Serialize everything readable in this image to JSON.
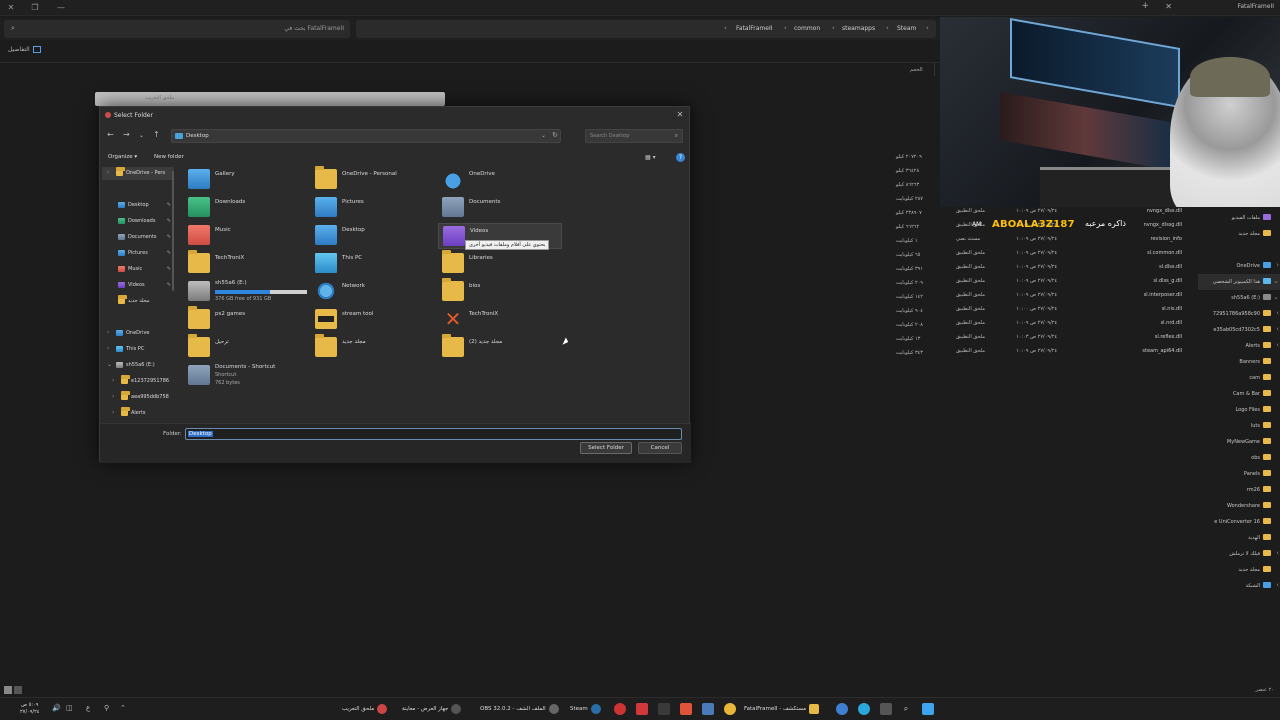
{
  "explorer": {
    "window_title": "FatalFrameII",
    "search_placeholder": "بحث في FatalFrameII",
    "breadcrumb": [
      "FatalFrameII",
      "common",
      "steamapps",
      "Steam"
    ],
    "details_label": "التفاصيل",
    "col_size": "الحجم",
    "sizes": [
      "٢٠٧٢٠٩ كيلو",
      "٣٦٤٢٨ كيلو",
      "٨٦٢٦٣ كيلو",
      "٢٨٧ كيلوبايت",
      "٢٣٨٩٠٧ كيلو",
      "٦٦٢٦٢ كيلو",
      "١ كيلوبايت",
      "٦٥ كيلوبايت",
      "٣٩١ كيلوبايت",
      "٢٠٩ كيلوبايت",
      "١٤٢ كيلوبايت",
      "٩٠٤ كيلوبايت",
      "٢٠٨ كيلوبايت",
      "١٣ كيلوبايت",
      "٣٤٣ كيلوبايت"
    ],
    "files": [
      {
        "name": "nvngx_dlss.dll",
        "date": "٢٧/٠٩/٢٤ ص ١٠:٠٩",
        "type": "ملحق التطبيق"
      },
      {
        "name": "nvngx_dlssg.dll",
        "date": "٢٧/٠٩/٢٤ ص ١٠:٠٩",
        "type": "ملحق التطبيق"
      },
      {
        "name": "revision_info",
        "date": "٢٧/٠٩/٢٤ ص ١٠:٠٩",
        "type": "مستند نصي"
      },
      {
        "name": "sl.common.dll",
        "date": "٢٧/٠٩/٢٤ ص ١٠:٠٩",
        "type": "ملحق التطبيق"
      },
      {
        "name": "sl.dlss.dll",
        "date": "٢٧/٠٩/٢٤ ص ١٠:٠٩",
        "type": "ملحق التطبيق"
      },
      {
        "name": "sl.dlss_g.dll",
        "date": "٢٧/٠٩/٢٤ ص ١٠:٠٩",
        "type": "ملحق التطبيق"
      },
      {
        "name": "sl.interposer.dll",
        "date": "٢٧/٠٩/٢٤ ص ١٠:٠٩",
        "type": "ملحق التطبيق"
      },
      {
        "name": "sl.nis.dll",
        "date": "٢٧/٠٩/٢٤ ص ١٠:٠٠",
        "type": "ملحق التطبيق"
      },
      {
        "name": "sl.nrd.dll",
        "date": "٢٧/٠٩/٢٤ ص ١٠:٠٩",
        "type": "ملحق التطبيق"
      },
      {
        "name": "sl.reflex.dll",
        "date": "٢٧/٠٩/٢٤ ص ١٠:٠٣",
        "type": "ملحق التطبيق"
      },
      {
        "name": "steam_api64.dll",
        "date": "٢٧/٠٩/٢٤ ص ١٠:٠٩",
        "type": "ملحق التطبيق"
      }
    ],
    "nav": [
      {
        "label": "ملفات الفيديو"
      },
      {
        "label": "مجلد جديد"
      },
      {
        "label": "OneDrive"
      },
      {
        "label": "هذا الكمبيوتر الشخصي"
      },
      {
        "label": "sh55a6 (E:)"
      },
      {
        "label": "72951786a958c90"
      },
      {
        "label": "e35ab05cd7302c5"
      },
      {
        "label": "Alerts"
      },
      {
        "label": "Banners"
      },
      {
        "label": "cam"
      },
      {
        "label": "Cam & Bar"
      },
      {
        "label": "Logo Files"
      },
      {
        "label": "luts"
      },
      {
        "label": "MyNewGame"
      },
      {
        "label": "obs"
      },
      {
        "label": "Panels"
      },
      {
        "label": "rm26"
      },
      {
        "label": "Wondershare"
      },
      {
        "label": "e UniConverter 16"
      },
      {
        "label": "الهدية"
      },
      {
        "label": "فيلك لا ترملش"
      },
      {
        "label": "مجلد جديد"
      },
      {
        "label": "الشبكة"
      }
    ],
    "status_count": "٢٠ عنصر"
  },
  "ghost_dialog_title": "ملحق التعريب",
  "dialog": {
    "title": "Select Folder",
    "address": "Desktop",
    "search_placeholder": "Search Desktop",
    "organize": "Organize ▾",
    "new_folder": "New folder",
    "sidebar": [
      {
        "label": "OneDrive - Pers"
      },
      {
        "label": "Desktop"
      },
      {
        "label": "Downloads"
      },
      {
        "label": "Documents"
      },
      {
        "label": "Pictures"
      },
      {
        "label": "Music"
      },
      {
        "label": "Videos"
      },
      {
        "label": "مجلد جديد"
      },
      {
        "label": "OneDrive"
      },
      {
        "label": "This PC"
      },
      {
        "label": "sh55a6 (E:)"
      },
      {
        "label": "e12372951786"
      },
      {
        "label": "aea995ddb758"
      },
      {
        "label": "Alerts"
      }
    ],
    "items": [
      {
        "name": "Gallery",
        "icon": "gallery-icon"
      },
      {
        "name": "OneDrive - Personal",
        "icon": "folder-icon"
      },
      {
        "name": "OneDrive",
        "icon": "cloud-icon"
      },
      {
        "name": "Downloads",
        "icon": "downloads-icon"
      },
      {
        "name": "Pictures",
        "icon": "pictures-icon"
      },
      {
        "name": "Documents",
        "icon": "documents-icon"
      },
      {
        "name": "Music",
        "icon": "music-icon"
      },
      {
        "name": "Desktop",
        "icon": "desktop-icon"
      },
      {
        "name": "Videos",
        "icon": "videos-icon"
      },
      {
        "name": "TechTroniX",
        "icon": "folder-icon"
      },
      {
        "name": "This PC",
        "icon": "pc-icon"
      },
      {
        "name": "Libraries",
        "icon": "folder-icon"
      },
      {
        "name": "sh55a6 (E:)",
        "icon": "drive-icon",
        "sub": "376 GB free of 931 GB",
        "used_fraction": 0.6
      },
      {
        "name": "Network",
        "icon": "network-icon"
      },
      {
        "name": "bios",
        "icon": "folder-icon"
      },
      {
        "name": "ps2 games",
        "icon": "folder-icon"
      },
      {
        "name": "stream tool",
        "icon": "folder-icon"
      },
      {
        "name": "TechTroniX",
        "icon": "x-logo-icon"
      },
      {
        "name": "ترحيل",
        "icon": "folder-icon"
      },
      {
        "name": "مجلد جديد",
        "icon": "folder-icon"
      },
      {
        "name": "مجلد جديد (2)",
        "icon": "folder-icon"
      },
      {
        "name": "Documents - Shortcut",
        "icon": "shortcut-icon",
        "sub": "Shortcut",
        "sub2": "762 bytes"
      }
    ],
    "tooltip": "يحتوي على أفلام وملفات فيديو أخرى",
    "folder_label": "Folder:",
    "folder_value": "Desktop",
    "select_button": "Select Folder",
    "cancel_button": "Cancel"
  },
  "overlay": {
    "name": "ABOALA3Z187",
    "arabic": "ذاكره مرعبه",
    "time_prefix": "AM"
  },
  "taskbar": {
    "clock_time": "٥:٠٩ ص",
    "clock_date": "٢٧/٠٩/٢٤",
    "apps": [
      {
        "label": "ملحق التعريب"
      },
      {
        "label": "جهاز العرض - معاينة"
      },
      {
        "label": "OBS 32.0.2 - الملف الشف"
      },
      {
        "label": "Steam"
      },
      {
        "label": "FatalFrameII - مستكشف"
      }
    ]
  }
}
